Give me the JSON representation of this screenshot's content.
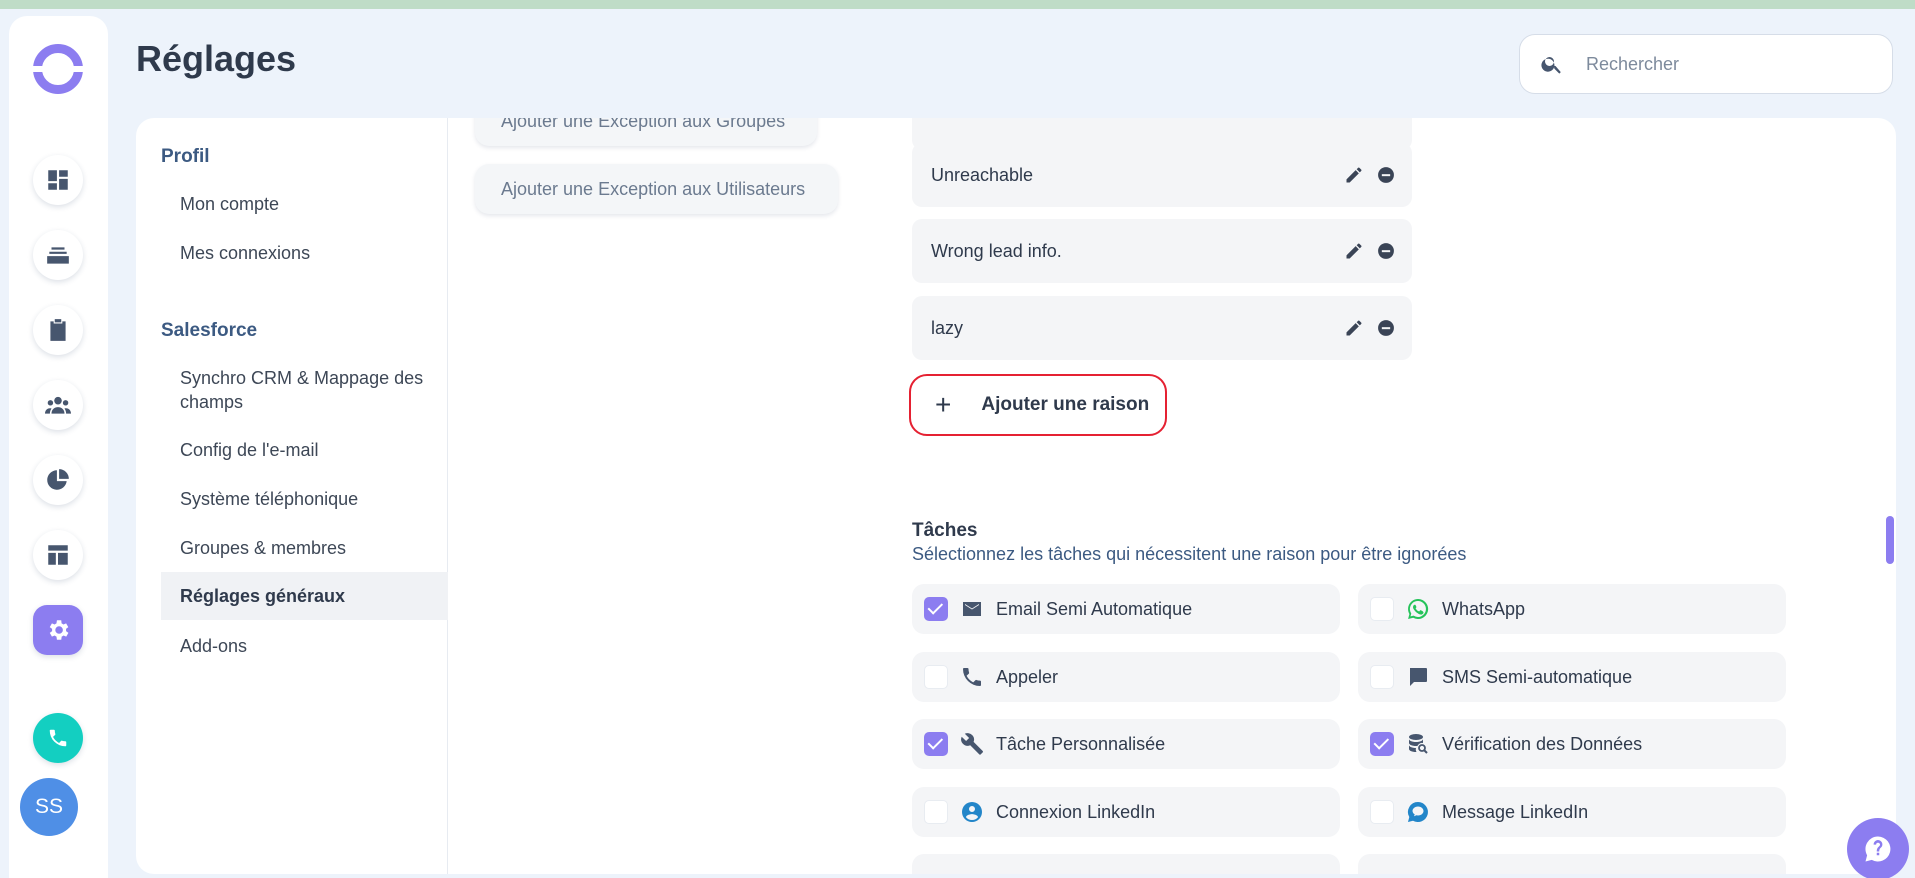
{
  "header": {
    "title": "Réglages",
    "search_placeholder": "Rechercher"
  },
  "avatar": {
    "initials": "SS"
  },
  "settings_nav": {
    "sections": [
      {
        "label": "Profil",
        "items": [
          "Mon compte",
          "Mes connexions"
        ]
      },
      {
        "label": "Salesforce",
        "items": [
          "Synchro CRM & Mappage des champs",
          "Config de l'e-mail",
          "Système téléphonique",
          "Groupes & membres",
          "Réglages généraux",
          "Add-ons"
        ]
      }
    ],
    "selected": "Réglages généraux"
  },
  "exceptions": {
    "groups_label": "Ajouter une Exception aux Groupes",
    "users_label": "Ajouter une Exception aux Utilisateurs"
  },
  "reasons": {
    "items": [
      "Unreachable",
      "Wrong lead info.",
      "lazy"
    ],
    "add_label": "Ajouter une raison"
  },
  "tasks": {
    "title": "Tâches",
    "subtitle": "Sélectionnez les tâches qui nécessitent une raison pour être ignorées",
    "items": [
      {
        "label": "Email Semi Automatique",
        "checked": true,
        "icon": "envelope-icon",
        "color": "#47566e"
      },
      {
        "label": "WhatsApp",
        "checked": false,
        "icon": "whatsapp-icon",
        "color": "#25c35a"
      },
      {
        "label": "Appeler",
        "checked": false,
        "icon": "phone-icon",
        "color": "#47566e"
      },
      {
        "label": "SMS Semi-automatique",
        "checked": false,
        "icon": "chat-bubble-icon",
        "color": "#47566e"
      },
      {
        "label": "Tâche Personnalisée",
        "checked": true,
        "icon": "wrench-icon",
        "color": "#47566e"
      },
      {
        "label": "Vérification des Données",
        "checked": true,
        "icon": "database-search-icon",
        "color": "#47566e"
      },
      {
        "label": "Connexion LinkedIn",
        "checked": false,
        "icon": "linkedin-person-icon",
        "color": "#2386c9"
      },
      {
        "label": "Message LinkedIn",
        "checked": false,
        "icon": "linkedin-message-icon",
        "color": "#2386c9"
      }
    ]
  },
  "colors": {
    "accent": "#8c7df0",
    "highlight_border": "#e52132",
    "phone": "#13cfc1",
    "avatar": "#4f8fe6"
  }
}
